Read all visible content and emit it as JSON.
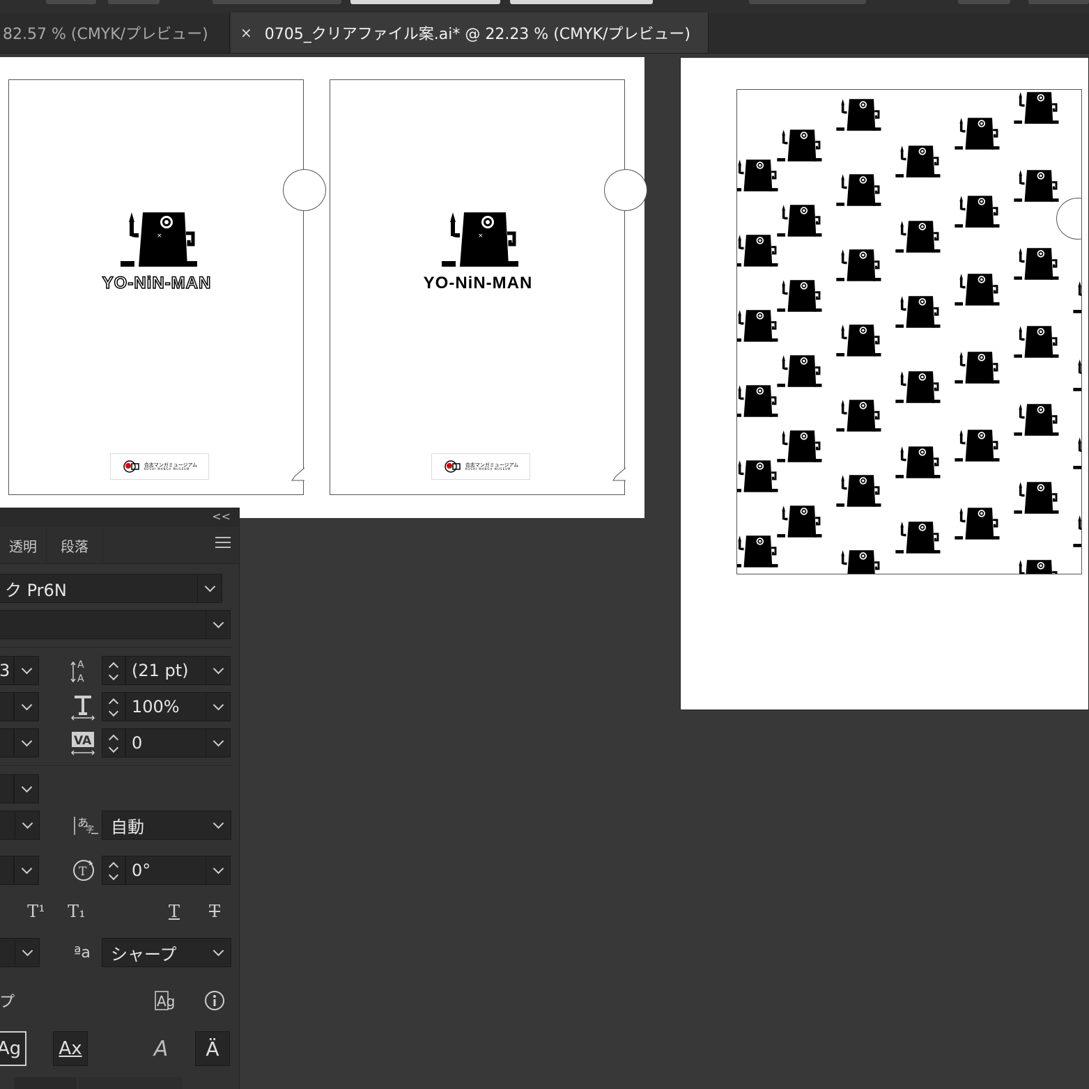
{
  "tabs": {
    "inactive_label": "82.57 % (CMYK/プレビュー)",
    "close_glyph": "×",
    "active_label": "0705_クリアファイル案.ai* @ 22.23 % (CMYK/プレビュー)"
  },
  "canvas": {
    "front_logo_text": "YO-NiN-MAN",
    "back_logo_text": "YO-NiN-MAN",
    "museum_line1": "合志マンガミュージアム",
    "museum_line2": "KOSHI MANGA MUSEUM"
  },
  "character_panel": {
    "collapse_glyph": "<<",
    "tab_transparency": "透明",
    "tab_paragraph": "段落",
    "font_family_value": "ク Pr6N",
    "font_style_value": "",
    "font_size_value": "3",
    "leading_value": "(21 pt)",
    "vertical_scale_value": "100%",
    "kerning_value": "0",
    "mojikumi_value": "自動",
    "rotation_value": "0°",
    "antialias_value": "シャープ",
    "truncated_label": "プ",
    "superscript_glyph": "T¹",
    "subscript_glyph": "T₁",
    "underline_glyph": "T",
    "strike_glyph": "T",
    "antialias_icon_glyph": "ªa",
    "btn_ag": "Ag",
    "btn_ax": "Ax",
    "btn_a1": "A",
    "btn_a2": "Ä"
  },
  "icons": [
    "close-icon",
    "menu-icon",
    "chevron-down-icon",
    "leading-icon",
    "vertical-scale-icon",
    "kerning-icon",
    "mojikumi-icon",
    "rotation-icon",
    "info-icon",
    "glyph-icon"
  ],
  "colors": {
    "canvas_bg": "#383838",
    "panel_bg": "#323232",
    "field_bg": "#262626",
    "paper": "#ffffff",
    "ink": "#000000"
  }
}
